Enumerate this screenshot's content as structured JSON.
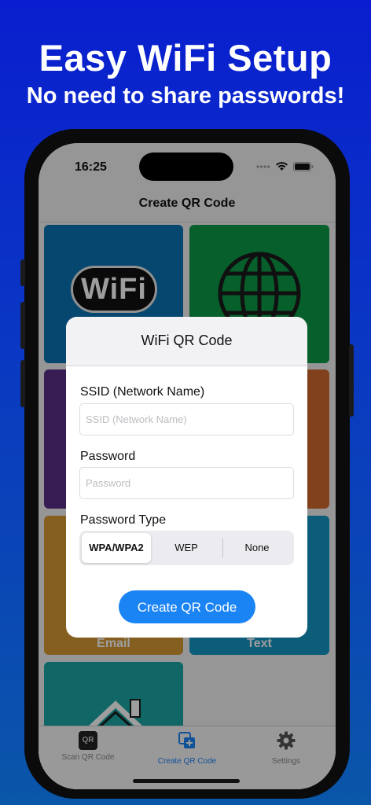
{
  "promo": {
    "headline": "Easy WiFi Setup",
    "subheadline": "No need to share passwords!"
  },
  "status_bar": {
    "time": "16:25"
  },
  "nav": {
    "title": "Create QR Code"
  },
  "tiles": {
    "wifi_text": "WiFi",
    "email_label": "Email",
    "text_label": "Text"
  },
  "colors": {
    "wifi_tile": "#0b73b5",
    "web_tile": "#0c9a46",
    "purple_tile": "#5b2f8a",
    "orange_tile": "#d06a30",
    "email_tile": "#d69a35",
    "text_tile": "#1496c4",
    "home_tile": "#1aa6a4",
    "accent": "#1b84f5"
  },
  "modal": {
    "title": "WiFi QR Code",
    "ssid_label": "SSID (Network Name)",
    "ssid_value": "",
    "ssid_placeholder": "SSID (Network Name)",
    "password_label": "Password",
    "password_value": "",
    "password_placeholder": "Password",
    "type_label": "Password Type",
    "types": [
      "WPA/WPA2",
      "WEP",
      "None"
    ],
    "selected_type": "WPA/WPA2",
    "create_button": "Create QR Code"
  },
  "tabbar": {
    "tabs": [
      {
        "label": "Scan QR Code",
        "icon": "qr-icon"
      },
      {
        "label": "Create QR Code",
        "icon": "create-qr-icon",
        "active": true
      },
      {
        "label": "Settings",
        "icon": "gear-icon"
      }
    ]
  }
}
